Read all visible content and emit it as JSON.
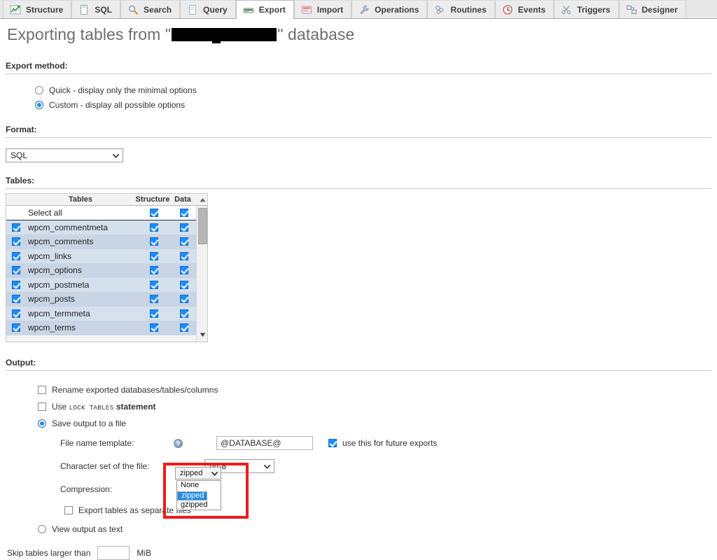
{
  "nav": {
    "tabs": [
      {
        "label": "Structure",
        "icon": "structure-icon",
        "active": false
      },
      {
        "label": "SQL",
        "icon": "sql-icon",
        "active": false
      },
      {
        "label": "Search",
        "icon": "search-icon",
        "active": false
      },
      {
        "label": "Query",
        "icon": "query-icon",
        "active": false
      },
      {
        "label": "Export",
        "icon": "export-icon",
        "active": true
      },
      {
        "label": "Import",
        "icon": "import-icon",
        "active": false
      },
      {
        "label": "Operations",
        "icon": "wrench-icon",
        "active": false
      },
      {
        "label": "Routines",
        "icon": "routines-icon",
        "active": false
      },
      {
        "label": "Events",
        "icon": "clock-icon",
        "active": false
      },
      {
        "label": "Triggers",
        "icon": "triggers-icon",
        "active": false
      },
      {
        "label": "Designer",
        "icon": "designer-icon",
        "active": false
      }
    ]
  },
  "title": {
    "prefix": "Exporting tables from \"",
    "database_name": "",
    "suffix": "\" database"
  },
  "export_method": {
    "heading": "Export method:",
    "options": [
      {
        "label": "Quick - display only the minimal options",
        "selected": false
      },
      {
        "label": "Custom - display all possible options",
        "selected": true
      }
    ]
  },
  "format": {
    "heading": "Format:",
    "value": "SQL",
    "options": [
      "SQL"
    ]
  },
  "tables": {
    "heading": "Tables:",
    "columns": [
      "",
      "Tables",
      "Structure",
      "Data"
    ],
    "select_all_label": "Select all",
    "select_all_structure": true,
    "select_all_data": true,
    "rows": [
      {
        "name": "wpcm_commentmeta",
        "selected": true,
        "structure": true,
        "data": true
      },
      {
        "name": "wpcm_comments",
        "selected": true,
        "structure": true,
        "data": true
      },
      {
        "name": "wpcm_links",
        "selected": true,
        "structure": true,
        "data": true
      },
      {
        "name": "wpcm_options",
        "selected": true,
        "structure": true,
        "data": true
      },
      {
        "name": "wpcm_postmeta",
        "selected": true,
        "structure": true,
        "data": true
      },
      {
        "name": "wpcm_posts",
        "selected": true,
        "structure": true,
        "data": true
      },
      {
        "name": "wpcm_termmeta",
        "selected": true,
        "structure": true,
        "data": true
      },
      {
        "name": "wpcm_terms",
        "selected": true,
        "structure": true,
        "data": true
      }
    ]
  },
  "output": {
    "heading": "Output:",
    "rename_label": "Rename exported databases/tables/columns",
    "rename_checked": false,
    "lock_prefix": "Use ",
    "lock_keyword": "LOCK TABLES",
    "lock_suffix": " statement",
    "lock_checked": false,
    "save_to_file_label": "Save output to a file",
    "save_to_file_selected": true,
    "filename_template_label": "File name template:",
    "filename_template_value": "@DATABASE@",
    "filename_help_glyph": "?",
    "future_exports_label": "use this for future exports",
    "future_exports_checked": true,
    "charset_label": "Character set of the file:",
    "charset_value": "utf-8",
    "compression_label": "Compression:",
    "compression_value": "zipped",
    "compression_options": [
      {
        "label": "None",
        "selected": false
      },
      {
        "label": "zipped",
        "selected": true
      },
      {
        "label": "gzipped",
        "selected": false
      }
    ],
    "separate_files_label": "Export tables as separate files",
    "separate_files_checked": false,
    "view_as_text_label": "View output as text",
    "view_as_text_selected": false
  },
  "skip": {
    "label": "Skip tables larger than",
    "value": "",
    "unit": "MiB"
  },
  "colors": {
    "accent_blue": "#1a8cff",
    "highlight_red": "#ee1c1c",
    "list_select_blue": "#1f8cf0",
    "row_odd": "#d6e0ed",
    "row_even": "#c9d5e5"
  }
}
